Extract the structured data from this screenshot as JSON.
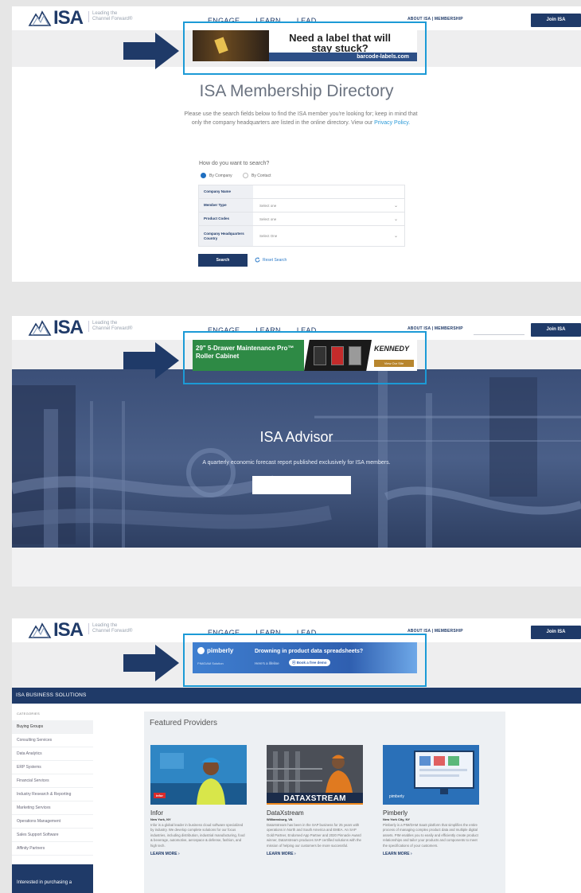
{
  "header": {
    "logo_text": "ISA",
    "tagline": "Leading the Channel Forward®",
    "nav": [
      "ENGAGE",
      "LEARN",
      "LEAD"
    ],
    "util": "ABOUT ISA  |  MEMBERSHIP",
    "join_label": "Join ISA"
  },
  "panel1": {
    "ad": {
      "headline": "Need a label that will stay stuck?",
      "domain": "barcode-labels.com"
    },
    "title": "ISA Membership Directory",
    "intro": "Please use the search fields below to find the ISA member you're looking for; keep in mind that only the company headquarters are listed in the online directory. View our",
    "intro_link": "Privacy Policy.",
    "question": "How do you want to search?",
    "radio_company": "By Company",
    "radio_contact": "By Contact",
    "form": [
      {
        "label": "Company Name",
        "value": ""
      },
      {
        "label": "Member Type",
        "value": "Select one"
      },
      {
        "label": "Product Codes",
        "value": "Select one"
      },
      {
        "label": "Company Headquarters Country",
        "value": "Select One"
      }
    ],
    "search_label": "Search",
    "reset_label": "Reset Search"
  },
  "panel2": {
    "ad": {
      "headline": "29\" 5-Drawer Maintenance Pro™ Roller Cabinet",
      "brand": "KENNEDY",
      "cta": "View Our Site"
    },
    "hero_title": "ISA Advisor",
    "hero_sub": "A quarterly economic forecast report published exclusively for ISA members."
  },
  "panel3": {
    "ad": {
      "brand": "pimberly",
      "brand_sub": "PIM/DAM Solution",
      "headline": "Drowning in product data spreadsheets?",
      "sub": "Here's a lifeline",
      "cta": "Book a free demo"
    },
    "bar_title": "ISA BUSINESS SOLUTIONS",
    "categories_title": "CATEGORIES",
    "categories": [
      "Buying Groups",
      "Consulting Services",
      "Data Analytics",
      "ERP Systems",
      "Financial Services",
      "Industry Research & Reporting",
      "Marketing Services",
      "Operations Management",
      "Sales Support Software",
      "Affinity Partners"
    ],
    "promo": "Interested in purchasing a",
    "featured_title": "Featured Providers",
    "providers": [
      {
        "name": "Infor",
        "location": "New York, NY",
        "badge": "infor",
        "desc": "Infor is a global leader in business cloud software specialized by industry. We develop complete solutions for our focus industries, including distribution, industrial manufacturing, food & beverage, automotive, aerospace & defense, fashion, and high tech.",
        "more": "LEARN MORE"
      },
      {
        "name": "DataXstream",
        "location": "Williamsburg, VA",
        "badge": "DATAXSTREAM",
        "desc": "DataXstream has been in the SAP business for 25 years with operations in North and South America and EMEA. An SAP Gold Partner, Endorsed App Partner and 2020 Pinnacle Award winner, DataXstream produces SAP certified solutions with the mission of helping our customers be more successful.",
        "more": "LEARN MORE"
      },
      {
        "name": "Pimberly",
        "location": "New York City, NY",
        "badge": "pimberly",
        "desc": "Pimberly is a PIM/DAM SaaS platform that simplifies the entire process of managing complex product data and multiple digital assets. PIM enables you to easily and efficiently create product relationships and tailor your products and components to meet the specifications of your customers.",
        "more": "LEARN MORE"
      }
    ]
  }
}
